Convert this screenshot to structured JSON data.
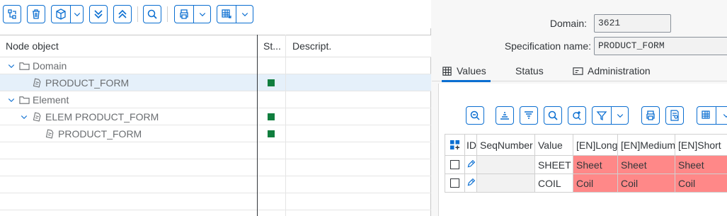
{
  "left_toolbar": {
    "buttons": [
      "hierarchy-icon",
      "delete-icon",
      "cube-icon",
      "collapse-all-icon",
      "expand-all-icon",
      "search-icon",
      "print-icon",
      "export-icon"
    ]
  },
  "tree": {
    "headers": {
      "node": "Node object",
      "status": "St...",
      "description": "Descript."
    },
    "rows": [
      {
        "label": "Domain",
        "level": 0,
        "expanded": true,
        "type": "folder",
        "status": false,
        "selected": false
      },
      {
        "label": "PRODUCT_FORM",
        "level": 1,
        "expanded": false,
        "type": "doc",
        "status": true,
        "selected": true
      },
      {
        "label": "Element",
        "level": 0,
        "expanded": true,
        "type": "folder",
        "status": false,
        "selected": false
      },
      {
        "label": "ELEM PRODUCT_FORM",
        "level": 1,
        "expanded": true,
        "type": "doc",
        "status": true,
        "selected": false
      },
      {
        "label": "PRODUCT_FORM",
        "level": 2,
        "expanded": false,
        "type": "doc",
        "status": true,
        "selected": false
      }
    ]
  },
  "form": {
    "domain_label": "Domain:",
    "domain_value": "3621",
    "spec_label": "Specification name:",
    "spec_value": "PRODUCT_FORM"
  },
  "tabs": [
    {
      "label": "Values",
      "icon": "values-grid-icon",
      "active": true
    },
    {
      "label": "Status",
      "icon": "",
      "active": false
    },
    {
      "label": "Administration",
      "icon": "administration-icon",
      "active": false
    }
  ],
  "grid": {
    "headers": {
      "id": "ID",
      "seq": "SeqNumber",
      "value": "Value",
      "long": "[EN]Long",
      "medium": "[EN]Medium",
      "short": "[EN]Short"
    },
    "rows": [
      {
        "value": "SHEET",
        "long": "Sheet",
        "medium": "Sheet",
        "short": "Sheet"
      },
      {
        "value": "COIL",
        "long": "Coil",
        "medium": "Coil",
        "short": "Coil"
      }
    ]
  },
  "colors": {
    "accent": "#0a6ed1",
    "status_green": "#107e3e",
    "highlight_red": "#ff8888",
    "selected_row": "#e5f0fa"
  }
}
